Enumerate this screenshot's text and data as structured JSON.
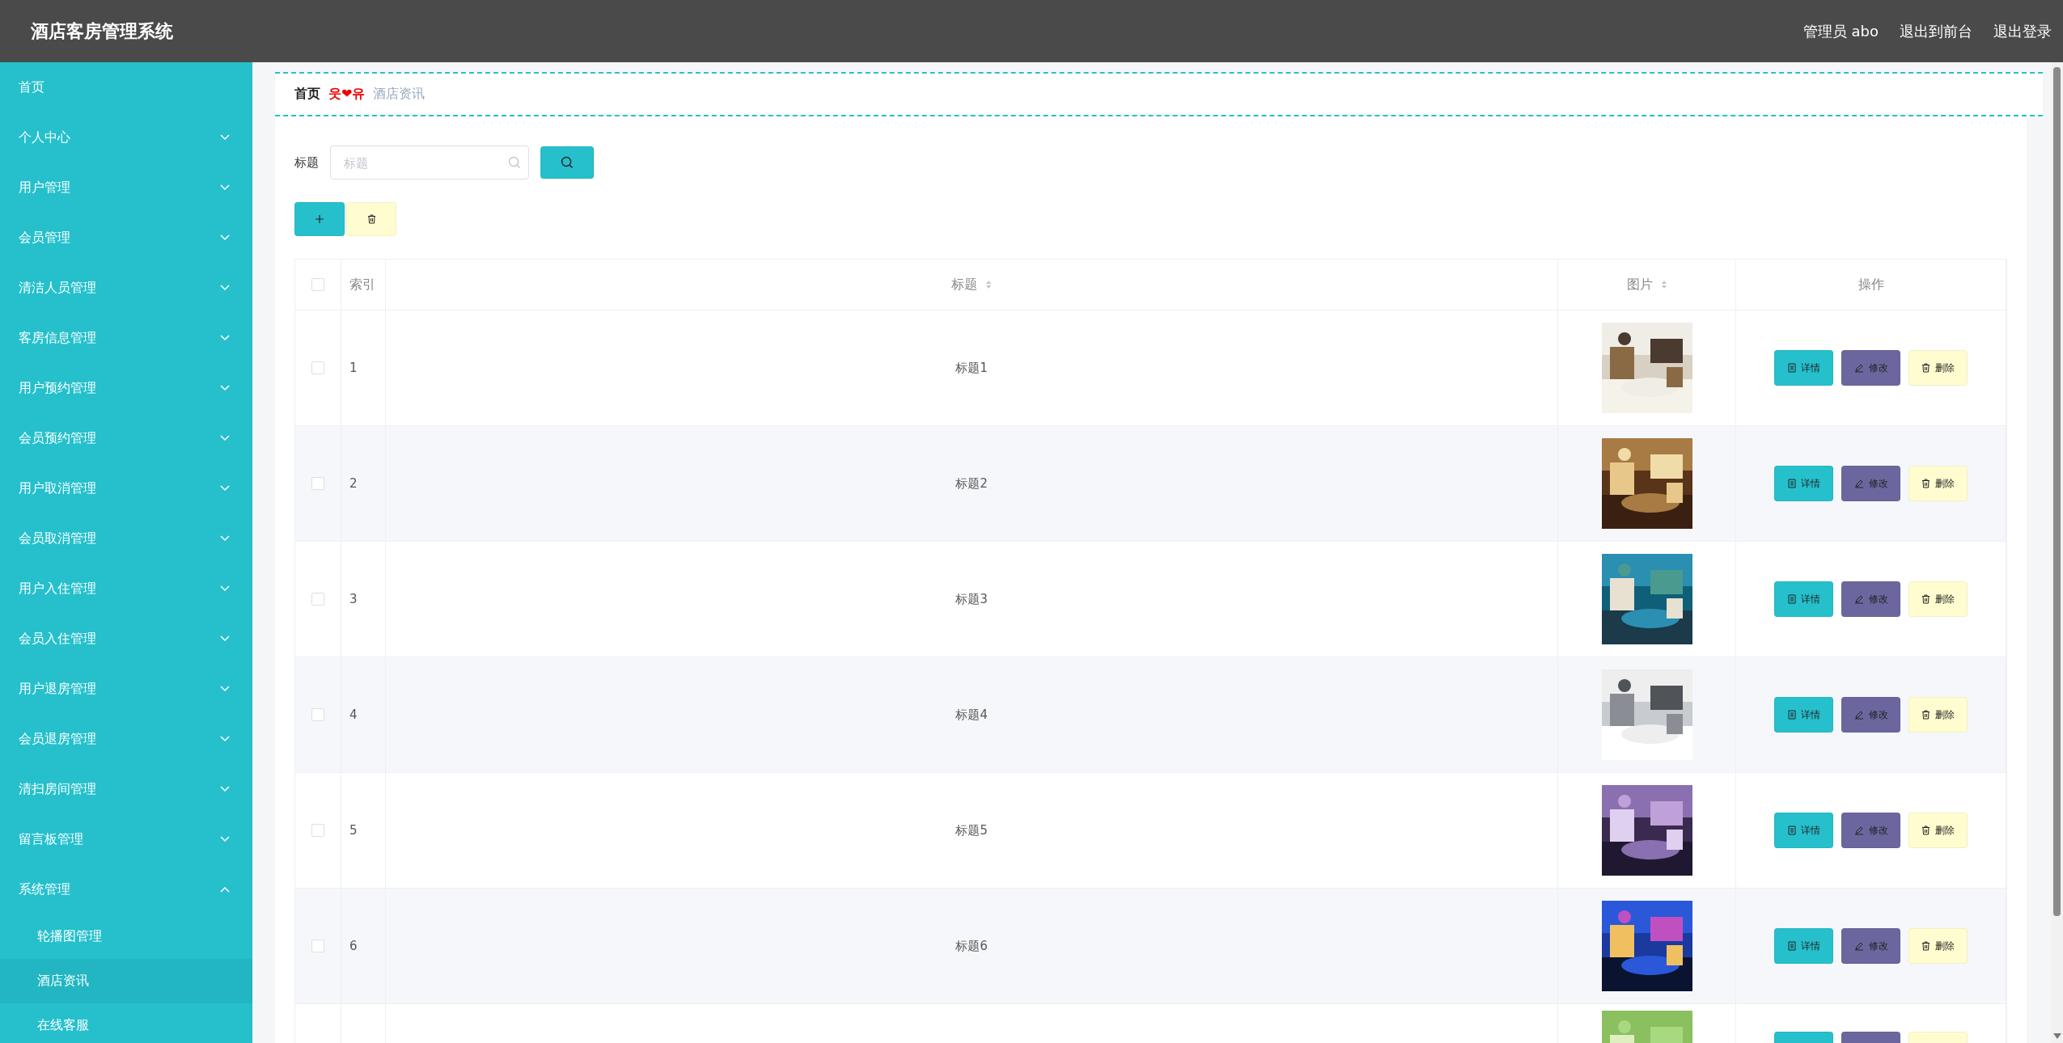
{
  "header": {
    "title": "酒店客房管理系统",
    "links": [
      "管理员 abo",
      "退出到前台",
      "退出登录"
    ]
  },
  "sidebar": {
    "items": [
      {
        "label": "首页"
      },
      {
        "label": "个人中心",
        "expanded": false
      },
      {
        "label": "用户管理",
        "expanded": false
      },
      {
        "label": "会员管理",
        "expanded": false
      },
      {
        "label": "清洁人员管理",
        "expanded": false
      },
      {
        "label": "客房信息管理",
        "expanded": false
      },
      {
        "label": "用户预约管理",
        "expanded": false
      },
      {
        "label": "会员预约管理",
        "expanded": false
      },
      {
        "label": "用户取消管理",
        "expanded": false
      },
      {
        "label": "会员取消管理",
        "expanded": false
      },
      {
        "label": "用户入住管理",
        "expanded": false
      },
      {
        "label": "会员入住管理",
        "expanded": false
      },
      {
        "label": "用户退房管理",
        "expanded": false
      },
      {
        "label": "会员退房管理",
        "expanded": false
      },
      {
        "label": "清扫房间管理",
        "expanded": false
      },
      {
        "label": "留言板管理",
        "expanded": false
      },
      {
        "label": "系统管理",
        "expanded": true,
        "children": [
          {
            "label": "轮播图管理",
            "selected": false
          },
          {
            "label": "酒店资讯",
            "selected": true
          },
          {
            "label": "在线客服",
            "selected": false
          }
        ]
      }
    ]
  },
  "breadcrumb": {
    "home": "首页",
    "separator": "웃❤유",
    "current": "酒店资讯"
  },
  "search": {
    "label": "标题",
    "placeholder": "标题"
  },
  "table": {
    "all_checked": false,
    "columns": [
      {
        "label": "索引",
        "sortable": false
      },
      {
        "label": "标题",
        "sortable": true
      },
      {
        "label": "图片",
        "sortable": true
      },
      {
        "label": "操作",
        "sortable": false
      }
    ],
    "rows": [
      {
        "kind": "full",
        "index": "1",
        "title": "标题1",
        "checked": false,
        "actions": [
          "详情",
          "修改",
          "删除"
        ]
      },
      {
        "kind": "full",
        "index": "2",
        "title": "标题2",
        "checked": false,
        "actions": [
          "详情",
          "修改",
          "删除"
        ]
      },
      {
        "kind": "full",
        "index": "3",
        "title": "标题3",
        "checked": false,
        "actions": [
          "详情",
          "修改",
          "删除"
        ]
      },
      {
        "kind": "full",
        "index": "4",
        "title": "标题4",
        "checked": false,
        "actions": [
          "详情",
          "修改",
          "删除"
        ]
      },
      {
        "kind": "full",
        "index": "5",
        "title": "标题5",
        "checked": false,
        "actions": [
          "详情",
          "修改",
          "删除"
        ]
      },
      {
        "kind": "full",
        "index": "6",
        "title": "标题6",
        "checked": false,
        "actions": [
          "详情",
          "修改",
          "删除"
        ]
      },
      {
        "kind": "cut"
      }
    ]
  }
}
